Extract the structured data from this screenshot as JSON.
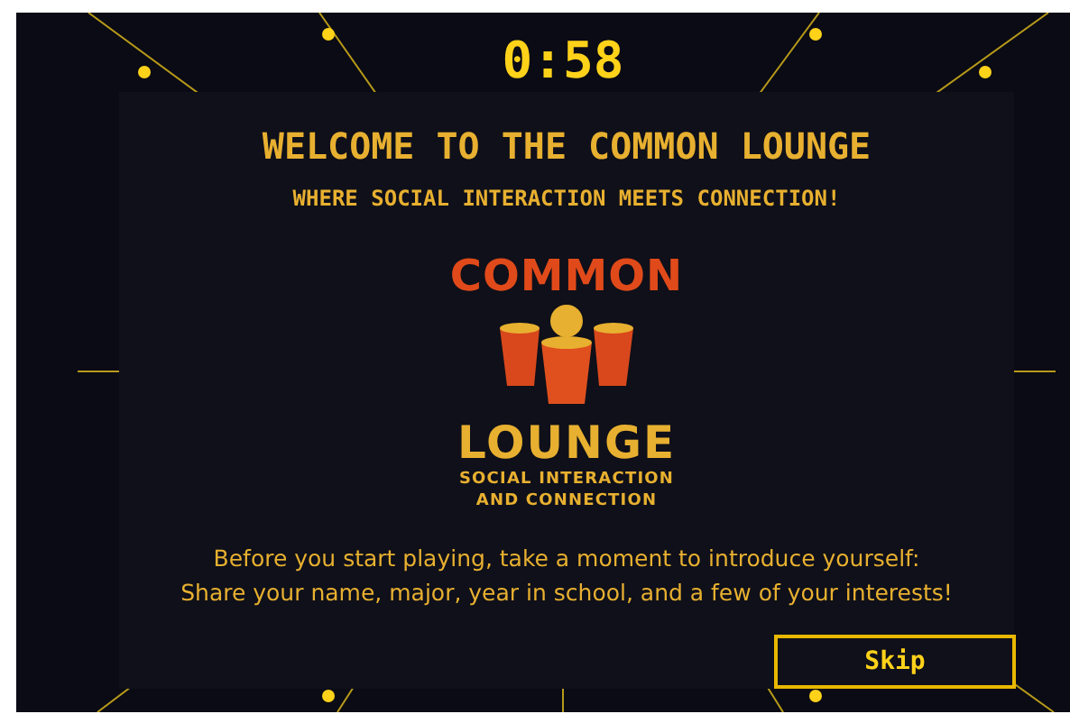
{
  "timer": "0:58",
  "title": "WELCOME TO THE COMMON LOUNGE",
  "subtitle": "WHERE SOCIAL INTERACTION MEETS CONNECTION!",
  "logo": {
    "top": "COMMON",
    "bottom": "LOUNGE",
    "tagline": [
      "SOCIAL INTERACTION",
      "AND CONNECTION"
    ]
  },
  "instructions": [
    "Before you start playing, take a moment to introduce yourself:",
    "Share your name, major, year in school, and a few of your interests!"
  ],
  "skip_button": "Skip"
}
